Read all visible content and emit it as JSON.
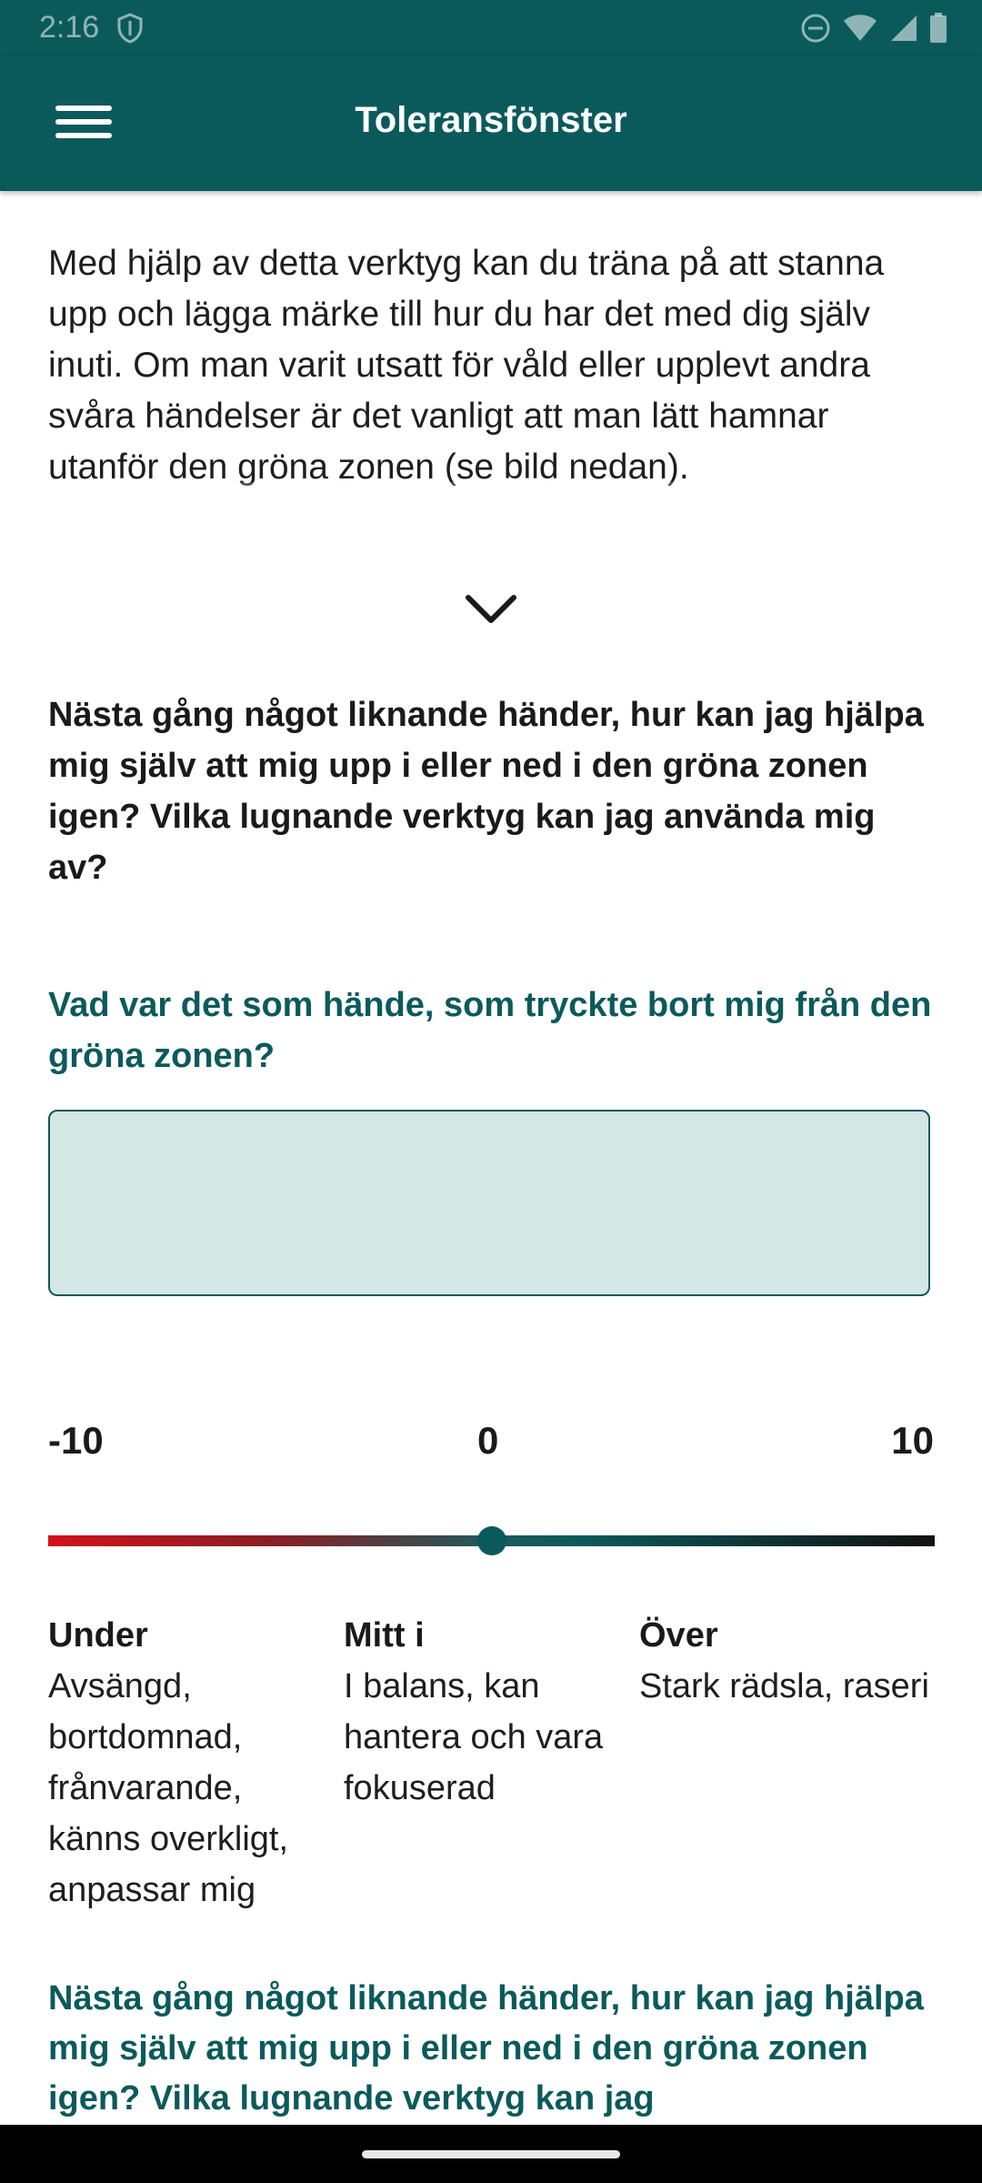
{
  "status_bar": {
    "time": "2:16",
    "icons": [
      "shield-icon",
      "dnd-icon",
      "wifi-icon",
      "signal-icon",
      "battery-icon"
    ]
  },
  "app_bar": {
    "title": "Toleransfönster",
    "menu_icon": "hamburger-menu-icon"
  },
  "intro": {
    "text": "Med hjälp av detta verktyg kan du träna på att stanna upp och lägga märke till hur du har det med dig själv inuti. Om man varit utsatt för våld eller upplevt andra svåra händelser är det vanligt att man lätt hamnar utanför den gröna zonen (se bild nedan).",
    "expand_icon": "chevron-down-icon"
  },
  "question_bold": "Nästa gång något liknande händer, hur kan jag hjälpa mig själv att mig upp i eller ned i den gröna zonen igen? Vilka lugnande verktyg kan jag använda mig av?",
  "incident_field": {
    "label": "Vad var det som hände, som tryckte bort mig från den gröna zonen?",
    "value": "",
    "placeholder": ""
  },
  "scale": {
    "min_label": "-10",
    "mid_label": "0",
    "max_label": "10",
    "min": -10,
    "max": 10,
    "value": 0
  },
  "zones": [
    {
      "title": "Under",
      "text": "Avsängd, bortdomnad, frånvarande, känns overkligt, anpassar mig"
    },
    {
      "title": "Mitt i",
      "text": "I balans, kan hantera och vara fokuserad"
    },
    {
      "title": "Över",
      "text": "Stark rädsla, raseri"
    }
  ],
  "next_question": "Nästa gång något liknande händer, hur kan jag hjälpa mig själv att mig upp i eller ned i den gröna zonen igen? Vilka lugnande verktyg kan jag",
  "colors": {
    "primary": "#0b5a5b",
    "field_bg": "#d3e7e4",
    "scale_low": "#d0121c",
    "scale_high": "#111111"
  }
}
